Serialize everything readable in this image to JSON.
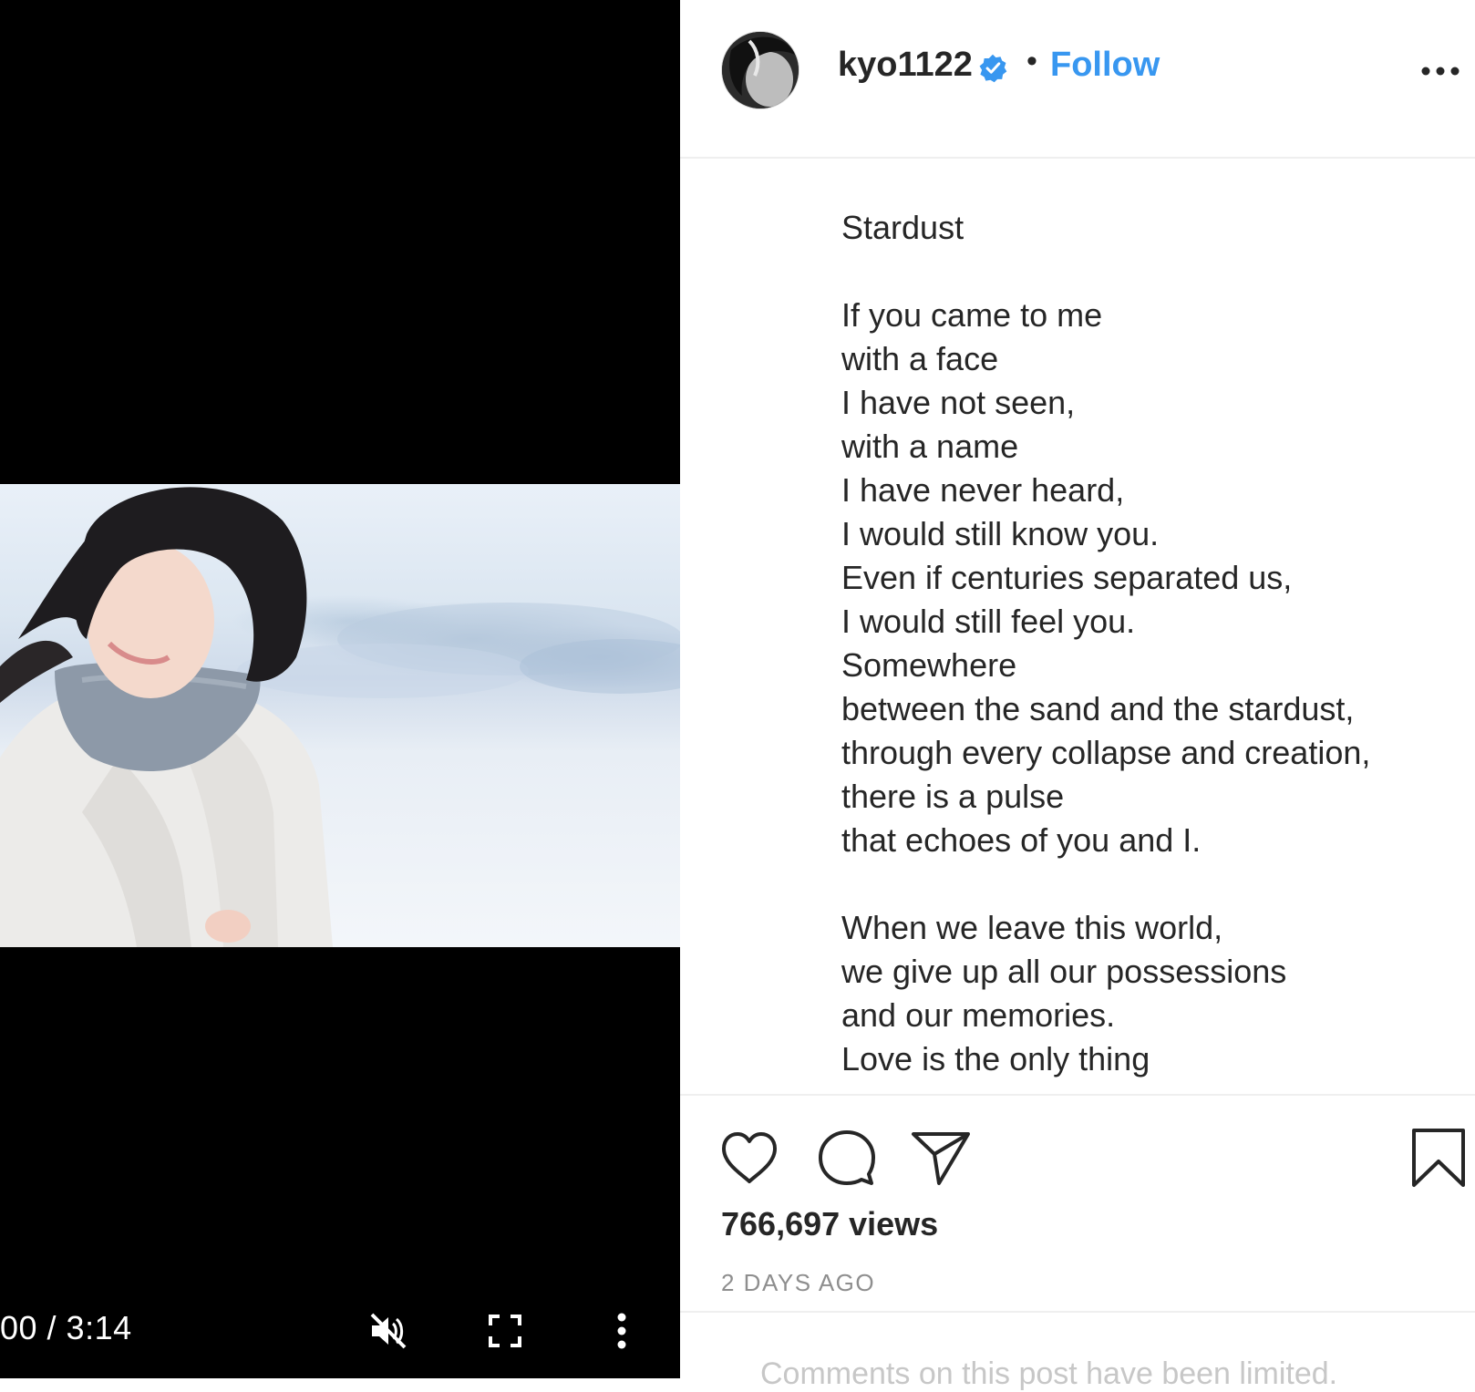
{
  "video": {
    "time_display": "00 / 3:14",
    "mute_icon": "speaker-muted-icon",
    "fullscreen_icon": "fullscreen-icon",
    "menu_icon": "vertical-dots-icon"
  },
  "header": {
    "username": "kyo1122",
    "verified_icon": "verified-badge-icon",
    "separator": "•",
    "follow_label": "Follow",
    "more_icon": "horizontal-dots-icon"
  },
  "caption": {
    "title": "Stardust",
    "lines": [
      "If you came to me",
      "with a face",
      "I have not seen,",
      "with a name",
      "I have never heard,",
      "I would still know you.",
      "Even if centuries separated us,",
      "I would still feel you.",
      "Somewhere",
      "between the sand and the stardust,",
      "through every collapse and creation,",
      "there is a pulse",
      "that echoes of you and I.",
      "When we leave this world,",
      "we give up all our possessions",
      "and our memories.",
      "Love is the only thing"
    ]
  },
  "actions": {
    "like_icon": "heart-icon",
    "comment_icon": "comment-bubble-icon",
    "share_icon": "paper-plane-icon",
    "save_icon": "bookmark-icon",
    "views": "766,697 views",
    "timestamp": "2 DAYS AGO"
  },
  "comments": {
    "notice": "Comments on this post have been limited."
  },
  "colors": {
    "accent": "#3897f0",
    "text": "#262626",
    "muted": "#8e8e8e"
  }
}
